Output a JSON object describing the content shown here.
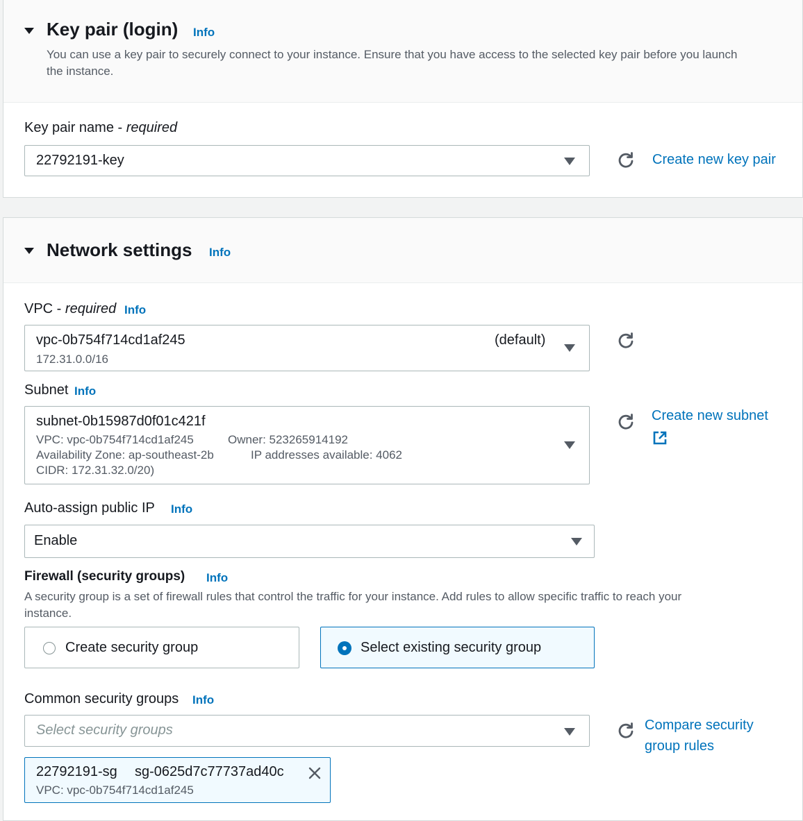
{
  "key_pair": {
    "title": "Key pair (login)",
    "info": "Info",
    "description_line1": "You can use a key pair to securely connect to your instance. Ensure that you have access to the selected key pair before you launch",
    "description_line2": "the instance.",
    "name_label": "Key pair name - ",
    "name_required": "required",
    "selected": "22792191-key",
    "create_link": "Create new key pair"
  },
  "network": {
    "title": "Network settings",
    "info": "Info",
    "vpc": {
      "label": "VPC - ",
      "required": "required",
      "info": "Info",
      "value": "vpc-0b754f714cd1af245",
      "default_tag": "(default)",
      "cidr": "172.31.0.0/16"
    },
    "subnet": {
      "label": "Subnet",
      "info": "Info",
      "value": "subnet-0b15987d0f01c421f",
      "vpc_line": "VPC: vpc-0b754f714cd1af245",
      "owner_line": "Owner: 523265914192",
      "az_line": "Availability Zone: ap-southeast-2b",
      "ips_line": "IP addresses available: 4062",
      "cidr_line": "CIDR: 172.31.32.0/20)",
      "create_link": "Create new subnet"
    },
    "auto_ip": {
      "label": "Auto-assign public IP",
      "info": "Info",
      "value": "Enable"
    },
    "firewall": {
      "label": "Firewall (security groups)",
      "info": "Info",
      "description_line1": "A security group is a set of firewall rules that control the traffic for your instance. Add rules to allow specific traffic to reach your",
      "description_line2": "instance.",
      "option_create": "Create security group",
      "option_existing": "Select existing security group",
      "selected_option": "existing"
    },
    "common_sg": {
      "label": "Common security groups",
      "info": "Info",
      "placeholder": "Select security groups",
      "compare_link_line1": "Compare security",
      "compare_link_line2": "group rules",
      "token_name": "22792191-sg",
      "token_id": "sg-0625d7c77737ad40c",
      "token_vpc": "VPC: vpc-0b754f714cd1af245"
    }
  },
  "colors": {
    "link": "#0073bb",
    "selected_bg": "#f1faff",
    "selected_border": "#0073bb",
    "field_border": "#aab7b8"
  }
}
